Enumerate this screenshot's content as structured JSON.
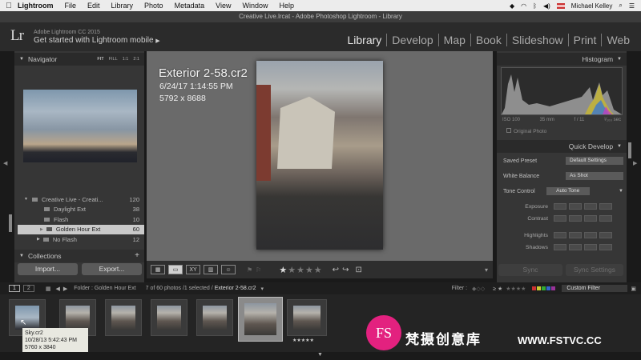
{
  "menubar": {
    "app": "Lightroom",
    "items": [
      "File",
      "Edit",
      "Library",
      "Photo",
      "Metadata",
      "View",
      "Window",
      "Help"
    ],
    "user": "Michael Kelley"
  },
  "window": {
    "title": "Creative Live.lrcat - Adobe Photoshop Lightroom - Library"
  },
  "identity": {
    "product": "Adobe Lightroom CC 2015",
    "prompt": "Get started with Lightroom mobile",
    "logo": "Lr"
  },
  "modules": [
    "Library",
    "Develop",
    "Map",
    "Book",
    "Slideshow",
    "Print",
    "Web"
  ],
  "navigator": {
    "title": "Navigator",
    "zoom": [
      "FIT",
      "FILL",
      "1:1",
      "2:1"
    ]
  },
  "collections": {
    "rows": [
      {
        "label": "Creative Live - Creati...",
        "count": "120"
      },
      {
        "label": "Daylight Ext",
        "count": "38"
      },
      {
        "label": "Flash",
        "count": "10"
      },
      {
        "label": "Golden Hour Ext",
        "count": "60"
      },
      {
        "label": "No Flash",
        "count": "12"
      }
    ],
    "title": "Collections",
    "import_label": "Import...",
    "export_label": "Export..."
  },
  "photo_info": {
    "filename": "Exterior 2-58.cr2",
    "datetime": "6/24/17 1:14:55 PM",
    "dimensions": "5792 x 8688"
  },
  "right_panel": {
    "histogram_title": "Histogram",
    "iso": "ISO 100",
    "focal": "35 mm",
    "aperture": "f / 11",
    "shutter": "¹⁄₁₀₀ sec",
    "original_photo": "Original Photo",
    "quick_develop_title": "Quick Develop",
    "saved_preset_label": "Saved Preset",
    "saved_preset_value": "Default Settings",
    "white_balance_label": "White Balance",
    "white_balance_value": "As Shot",
    "tone_control_label": "Tone Control",
    "auto_tone_label": "Auto Tone",
    "adjustments": [
      "Exposure",
      "Contrast",
      "Highlights",
      "Shadows"
    ],
    "sync_label": "Sync",
    "sync_settings_label": "Sync Settings"
  },
  "filmstrip_bar": {
    "folder_label": "Folder : Golden Hour Ext",
    "count_text": "7 of 60 photos /1 selected /",
    "selected_file": "Exterior 2-58.cr2",
    "filter_label": "Filter :",
    "filter_value": "Custom Filter",
    "pages": [
      "1",
      "2"
    ]
  },
  "tooltip": {
    "name": "Sky.cr2",
    "datetime": "10/28/13 5:42:43 PM",
    "dimensions": "5760 x 3840"
  },
  "watermark": {
    "badge": "FS",
    "chinese": "梵摄创意库",
    "url": "WWW.FSTVC.CC"
  }
}
